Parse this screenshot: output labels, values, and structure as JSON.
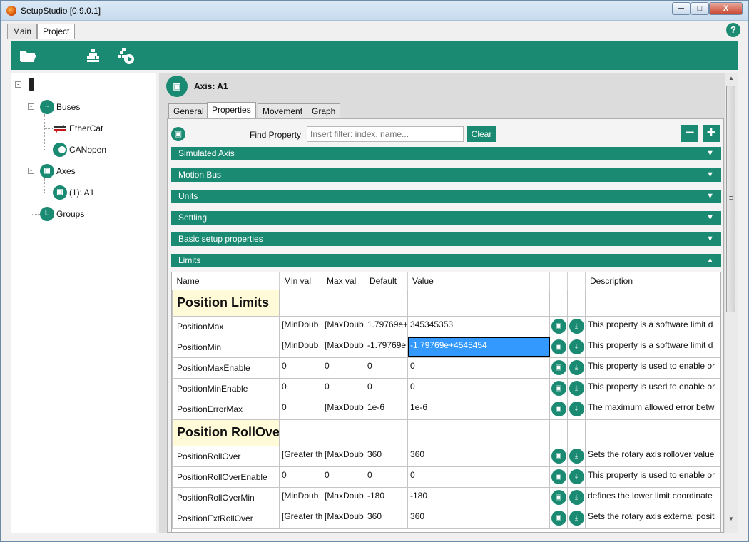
{
  "window": {
    "title": "SetupStudio [0.9.0.1]",
    "min": "─",
    "max": "□",
    "close": "X"
  },
  "top_tabs": [
    "Main",
    "Project"
  ],
  "help": "?",
  "tree": {
    "buses": "Buses",
    "ethercat": "EtherCat",
    "canopen": "CANopen",
    "axes": "Axes",
    "axis_a1": "(1): A1",
    "groups": "Groups"
  },
  "axis_header": "Axis: A1",
  "sub_tabs": [
    "General",
    "Properties",
    "Movement",
    "Graph"
  ],
  "find": {
    "label": "Find Property",
    "placeholder": "Insert filter: index, name...",
    "clear": "Clear"
  },
  "pm": {
    "minus": "−",
    "plus": "+"
  },
  "sections": [
    "Simulated Axis",
    "Motion Bus",
    "Units",
    "Settling",
    "Basic setup properties",
    "Limits"
  ],
  "grid": {
    "headers": [
      "Name",
      "Min val",
      "Max val",
      "Default",
      "Value",
      "",
      "",
      "Description"
    ],
    "groups": [
      "Position Limits",
      "Position RollOver"
    ],
    "rows": [
      {
        "name": "PositionMax",
        "min": "[MinDoub",
        "max": "[MaxDoub",
        "def": "1.79769e+",
        "val": "345345353",
        "desc": "This property is a software limit d"
      },
      {
        "name": "PositionMin",
        "min": "[MinDoub",
        "max": "[MaxDoub",
        "def": "-1.79769e",
        "val": "-1.79769e+4545454",
        "desc": "This property is a software limit d"
      },
      {
        "name": "PositionMaxEnable",
        "min": "0",
        "max": "0",
        "def": "0",
        "val": "0",
        "desc": "This property is used to enable or"
      },
      {
        "name": "PositionMinEnable",
        "min": "0",
        "max": "0",
        "def": "0",
        "val": "0",
        "desc": "This property is used to enable or"
      },
      {
        "name": "PositionErrorMax",
        "min": "0",
        "max": "[MaxDoub",
        "def": "1e-6",
        "val": "1e-6",
        "desc": "The maximum allowed error betw"
      },
      {
        "name": "PositionRollOver",
        "min": "[Greater th",
        "max": "[MaxDoub",
        "def": "360",
        "val": "360",
        "desc": "Sets the rotary axis rollover value"
      },
      {
        "name": "PositionRollOverEnable",
        "min": "0",
        "max": "0",
        "def": "0",
        "val": "0",
        "desc": "This property is used to enable or"
      },
      {
        "name": "PositionRollOverMin",
        "min": "[MinDoub",
        "max": "[MaxDoub",
        "def": "-180",
        "val": "-180",
        "desc": "defines the lower limit coordinate"
      },
      {
        "name": "PositionExtRollOver",
        "min": "[Greater th",
        "max": "[MaxDoub",
        "def": "360",
        "val": "360",
        "desc": "Sets the rotary axis external posit"
      }
    ]
  },
  "scroll": {
    "up": "▲",
    "down": "▼",
    "grip": "≡"
  }
}
